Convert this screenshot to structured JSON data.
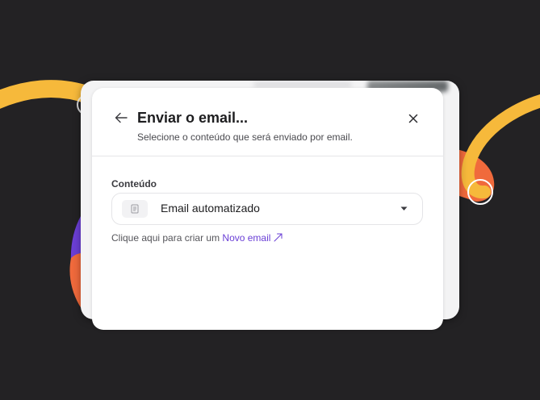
{
  "modal": {
    "title": "Enviar o email...",
    "subtitle": "Selecione o conteúdo que será enviado por email.",
    "back_icon": "arrow-left-icon",
    "close_icon": "close-icon"
  },
  "content_field": {
    "label": "Conteúdo",
    "selected_value": "Email automatizado",
    "leading_icon": "document-icon",
    "caret_icon": "caret-down-icon"
  },
  "hint": {
    "text": "Clique aqui para criar um ",
    "link_label": "Novo email",
    "link_icon": "external-arrow-icon"
  },
  "colors": {
    "background": "#232224",
    "accent_link": "#6a3fd6",
    "decor_yellow": "#f6b93b",
    "decor_orange": "#f06a3c",
    "decor_purple": "#6b3fd6"
  }
}
